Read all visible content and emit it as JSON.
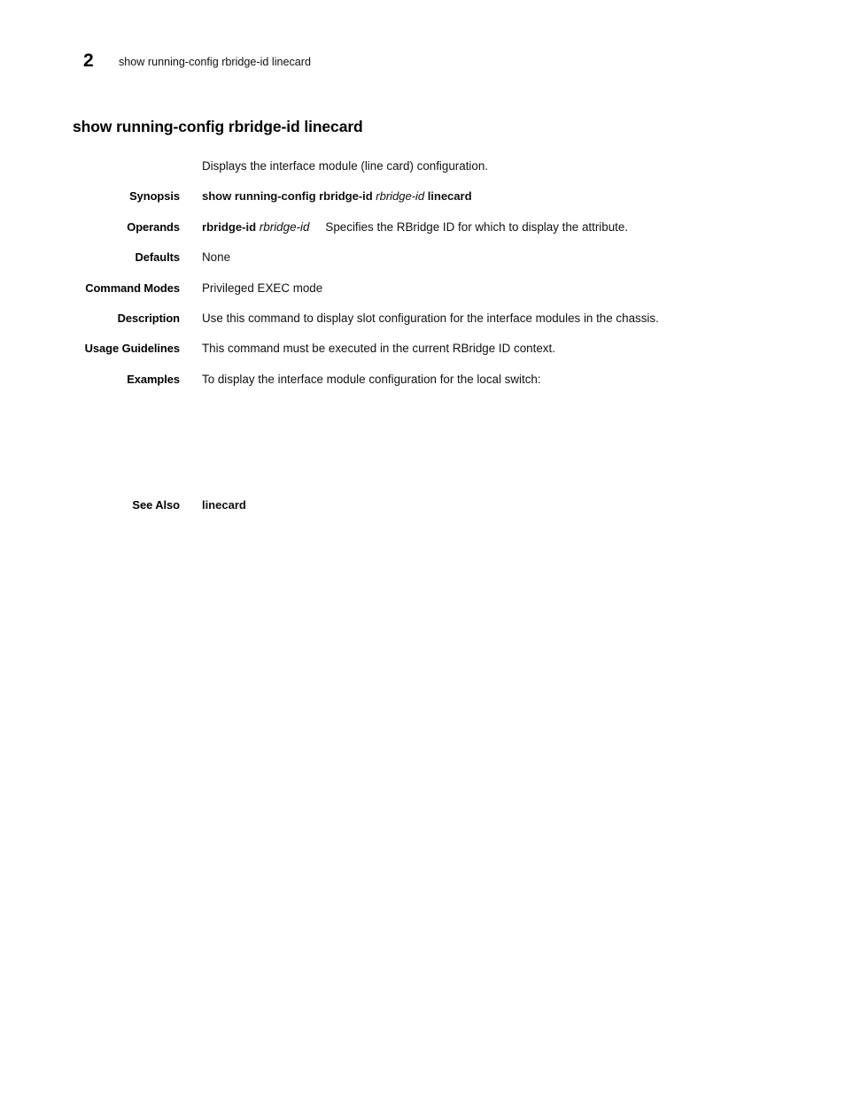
{
  "header": {
    "page_number": "2",
    "running_title": "show running-config rbridge-id linecard"
  },
  "heading": "show running-config rbridge-id linecard",
  "intro": "Displays the interface module (line card) configuration.",
  "sections": {
    "synopsis": {
      "label": "Synopsis",
      "command_prefix": "show running-config rbridge-id",
      "command_variable": "rbridge-id",
      "command_suffix": "linecard"
    },
    "operands": {
      "label": "Operands",
      "term": "rbridge-id",
      "term_variable": "rbridge-id",
      "description": "Specifies the RBridge ID for which to display the attribute."
    },
    "defaults": {
      "label": "Defaults",
      "value": "None"
    },
    "command_modes": {
      "label": "Command Modes",
      "value": "Privileged EXEC mode"
    },
    "description": {
      "label": "Description",
      "value": "Use this command to display slot configuration for the interface modules in the chassis."
    },
    "usage_guidelines": {
      "label": "Usage Guidelines",
      "value": "This command must be executed in the current RBridge ID context."
    },
    "examples": {
      "label": "Examples",
      "value": "To display the interface module configuration for the local switch:",
      "code": ""
    },
    "see_also": {
      "label": "See Also",
      "value": "linecard"
    }
  },
  "colors": {
    "page_background": "#ffffff",
    "text": "#111111",
    "heading": "#000000"
  }
}
